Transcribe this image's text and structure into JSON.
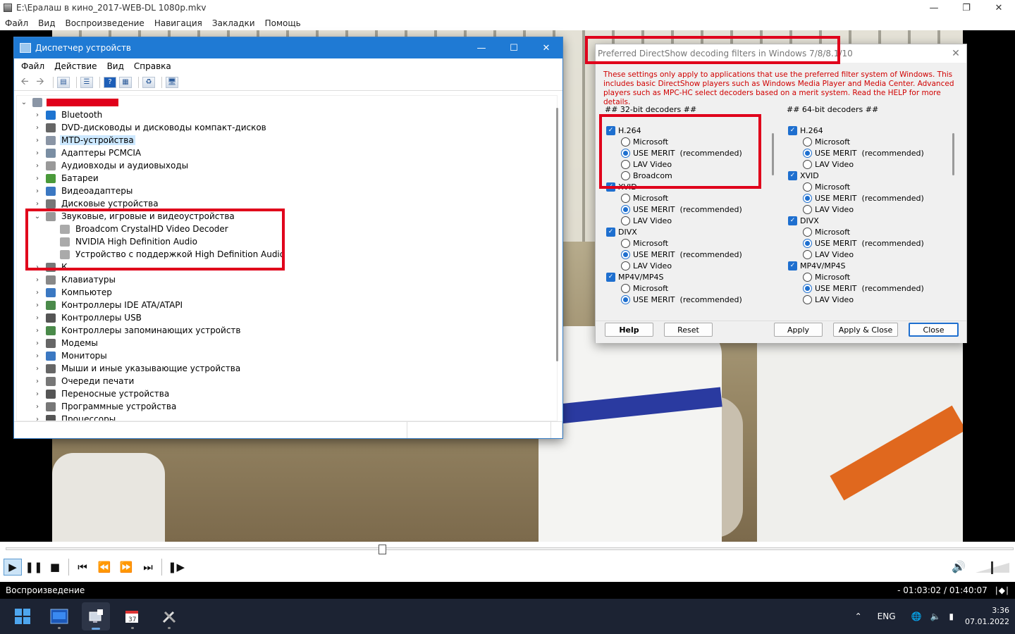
{
  "player": {
    "title": "E:\\Ералаш в кино_2017-WEB-DL 1080p.mkv",
    "menu": [
      "Файл",
      "Вид",
      "Воспроизведение",
      "Навигация",
      "Закладки",
      "Помощь"
    ],
    "seek_fraction": 0.37,
    "volume_fraction": 0.45,
    "status_left": "Воспроизведение",
    "status_time": "- 01:03:02 / 01:40:07"
  },
  "devmgr": {
    "title": "Диспетчер устройств",
    "menu": [
      "Файл",
      "Действие",
      "Вид",
      "Справка"
    ],
    "tree": [
      {
        "label": "Bluetooth",
        "expanded": false,
        "icon_color": "#1e74d0"
      },
      {
        "label": "DVD-дисководы и дисководы компакт-дисков",
        "expanded": false,
        "icon_color": "#666"
      },
      {
        "label": "MTD-устройства",
        "expanded": false,
        "icon_color": "#8a95a5",
        "selected": true
      },
      {
        "label": "Адаптеры PCMCIA",
        "expanded": false,
        "icon_color": "#7a8ea3"
      },
      {
        "label": "Аудиовходы и аудиовыходы",
        "expanded": false,
        "icon_color": "#999"
      },
      {
        "label": "Батареи",
        "expanded": false,
        "icon_color": "#4a9a3a"
      },
      {
        "label": "Видеоадаптеры",
        "expanded": false,
        "icon_color": "#3b78c2"
      },
      {
        "label": "Дисковые устройства",
        "expanded": false,
        "icon_color": "#777"
      },
      {
        "label": "Звуковые, игровые и видеоустройства",
        "expanded": true,
        "icon_color": "#999",
        "children": [
          "Broadcom CrystalHD Video Decoder",
          "NVIDIA High Definition Audio",
          "Устройство с поддержкой High Definition Audio"
        ]
      },
      {
        "label": "К...",
        "expanded": false,
        "icon_color": "#777"
      },
      {
        "label": "Клавиатуры",
        "expanded": false,
        "icon_color": "#888"
      },
      {
        "label": "Компьютер",
        "expanded": false,
        "icon_color": "#3b78c2"
      },
      {
        "label": "Контроллеры IDE ATA/ATAPI",
        "expanded": false,
        "icon_color": "#4a8a4a"
      },
      {
        "label": "Контроллеры USB",
        "expanded": false,
        "icon_color": "#555"
      },
      {
        "label": "Контроллеры запоминающих устройств",
        "expanded": false,
        "icon_color": "#4a8a4a"
      },
      {
        "label": "Модемы",
        "expanded": false,
        "icon_color": "#666"
      },
      {
        "label": "Мониторы",
        "expanded": false,
        "icon_color": "#3b78c2"
      },
      {
        "label": "Мыши и иные указывающие устройства",
        "expanded": false,
        "icon_color": "#666"
      },
      {
        "label": "Очереди печати",
        "expanded": false,
        "icon_color": "#777"
      },
      {
        "label": "Переносные устройства",
        "expanded": false,
        "icon_color": "#555"
      },
      {
        "label": "Программные устройства",
        "expanded": false,
        "icon_color": "#777"
      },
      {
        "label": "Процессоры",
        "expanded": false,
        "icon_color": "#555"
      }
    ]
  },
  "dshow": {
    "title": "Preferred DirectShow decoding filters in Windows 7/8/8.1/10",
    "note": "These settings only apply to applications that use the preferred filter system of Windows. This includes basic DirectShow players such as Windows Media Player and Media Center. Advanced players such as MPC-HC select decoders based on a merit system. Read the HELP for more details.",
    "col32_header": "##  32-bit decoders  ##",
    "col64_header": "##  64-bit decoders  ##",
    "col32": [
      {
        "codec": "H.264",
        "options": [
          "Microsoft",
          "USE MERIT  (recommended)",
          "LAV Video",
          "Broadcom"
        ],
        "selected": 1
      },
      {
        "codec": "XVID",
        "options": [
          "Microsoft",
          "USE MERIT  (recommended)",
          "LAV Video"
        ],
        "selected": 1
      },
      {
        "codec": "DIVX",
        "options": [
          "Microsoft",
          "USE MERIT  (recommended)",
          "LAV Video"
        ],
        "selected": 1
      },
      {
        "codec": "MP4V/MP4S",
        "options": [
          "Microsoft",
          "USE MERIT  (recommended)"
        ],
        "selected": 1
      }
    ],
    "col64": [
      {
        "codec": "H.264",
        "options": [
          "Microsoft",
          "USE MERIT  (recommended)",
          "LAV Video"
        ],
        "selected": 1
      },
      {
        "codec": "XVID",
        "options": [
          "Microsoft",
          "USE MERIT  (recommended)",
          "LAV Video"
        ],
        "selected": 1
      },
      {
        "codec": "DIVX",
        "options": [
          "Microsoft",
          "USE MERIT  (recommended)",
          "LAV Video"
        ],
        "selected": 1
      },
      {
        "codec": "MP4V/MP4S",
        "options": [
          "Microsoft",
          "USE MERIT  (recommended)",
          "LAV Video"
        ],
        "selected": 1
      }
    ],
    "buttons": {
      "help": "Help",
      "reset": "Reset",
      "apply": "Apply",
      "apply_close": "Apply & Close",
      "close": "Close"
    }
  },
  "taskbar": {
    "lang": "ENG",
    "time": "3:36",
    "date": "07.01.2022"
  },
  "accent": "#e0001b"
}
